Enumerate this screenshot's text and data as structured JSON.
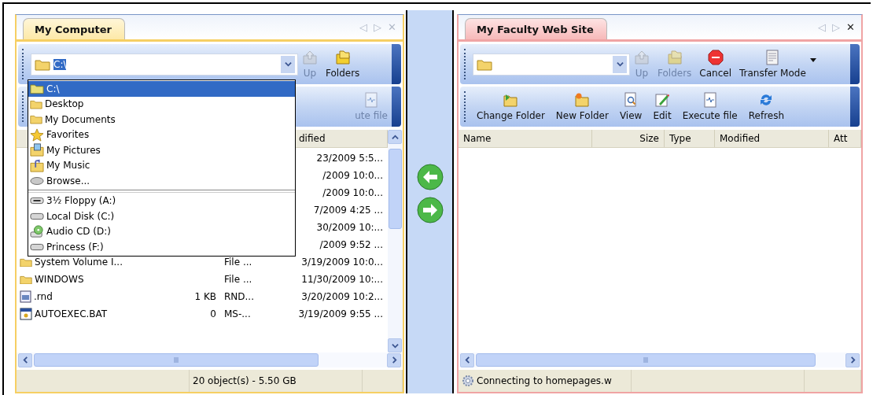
{
  "panes": [
    {
      "kind": "local",
      "tab": {
        "label": "My Computer",
        "selected": true
      },
      "tab_controls": [
        "◁",
        "▷",
        "✕"
      ],
      "close_enabled": false,
      "address": {
        "value": "C:\\",
        "highlighted": true
      },
      "toolbar_1": [
        {
          "label": "Up",
          "kind": "up",
          "disabled": true
        },
        {
          "label": "Folders",
          "kind": "folders",
          "disabled": false
        }
      ],
      "toolbar_2": [
        {
          "label": "ute file",
          "kind": "execute",
          "disabled": true
        }
      ],
      "columns": [
        null,
        null,
        null,
        "dified"
      ],
      "rows": [
        {
          "cells": [
            null,
            null,
            null,
            "23/2009 5:5..."
          ]
        },
        {
          "cells": [
            null,
            null,
            null,
            "/2009 10:0..."
          ]
        },
        {
          "cells": [
            null,
            null,
            null,
            "/2009 10:0..."
          ]
        },
        {
          "cells": [
            null,
            null,
            null,
            "7/2009 4:25 ..."
          ]
        },
        {
          "cells": [
            null,
            null,
            null,
            "30/2009 10:..."
          ]
        },
        {
          "cells": [
            null,
            null,
            null,
            "/2009 9:52 ..."
          ]
        },
        {
          "kind": "folder",
          "cells": [
            "System Volume I...",
            null,
            "File ...",
            "3/19/2009 10:0..."
          ]
        },
        {
          "kind": "folder",
          "cells": [
            "WINDOWS",
            null,
            "File ...",
            "11/30/2009 10:..."
          ]
        },
        {
          "kind": "file",
          "cells": [
            ".rnd",
            "1 KB",
            "RND...",
            "3/20/2009 10:2..."
          ]
        },
        {
          "kind": "program",
          "cells": [
            "AUTOEXEC.BAT",
            "0",
            "MS-...",
            "3/19/2009 9:55 ..."
          ]
        }
      ],
      "dropdown": {
        "places": [
          {
            "label": "C:\\",
            "kind": "drive-folder",
            "selected": true
          },
          {
            "label": "Desktop",
            "kind": "folder",
            "selected": false
          },
          {
            "label": "My Documents",
            "kind": "folder",
            "selected": false
          },
          {
            "label": "Favorites",
            "kind": "star",
            "selected": false
          },
          {
            "label": "My Pictures",
            "kind": "pictures",
            "selected": false
          },
          {
            "label": "My Music",
            "kind": "music",
            "selected": false
          },
          {
            "label": "Browse...",
            "kind": "browse",
            "selected": false
          }
        ],
        "drives": [
          {
            "label": "3½ Floppy (A:)",
            "kind": "floppy",
            "selected": false
          },
          {
            "label": "Local Disk (C:)",
            "kind": "disk",
            "selected": false
          },
          {
            "label": "Audio CD (D:)",
            "kind": "cd",
            "selected": false
          },
          {
            "label": "Princess (F:)",
            "kind": "disk",
            "selected": false
          }
        ]
      },
      "status": {
        "text": "20 object(s) - 5.50 GB"
      }
    },
    {
      "kind": "remote",
      "tab": {
        "label": "My Faculty Web Site",
        "selected": true
      },
      "tab_controls": [
        "◁",
        "▷",
        "✕"
      ],
      "close_enabled": true,
      "toolbar_1": [
        {
          "label": "Up",
          "kind": "up",
          "disabled": true
        },
        {
          "label": "Folders",
          "kind": "folders",
          "disabled": true
        },
        {
          "label": "Cancel",
          "kind": "stop",
          "disabled": false
        },
        {
          "label": "Transfer Mode",
          "kind": "transfer",
          "disabled": false,
          "menu": true
        }
      ],
      "toolbar_2": [
        {
          "label": "Change Folder",
          "kind": "change-folder",
          "disabled": false
        },
        {
          "label": "New Folder",
          "kind": "new-folder",
          "disabled": false
        },
        {
          "label": "View",
          "kind": "view",
          "disabled": false
        },
        {
          "label": "Edit",
          "kind": "edit",
          "disabled": false
        },
        {
          "label": "Execute file",
          "kind": "execute",
          "disabled": false
        },
        {
          "label": "Refresh",
          "kind": "refresh",
          "disabled": false
        }
      ],
      "columns": [
        "Name",
        "Size",
        "Type",
        "Modified",
        "Att"
      ],
      "status": {
        "text": "Connecting to homepages.w",
        "busy": true
      }
    }
  ]
}
